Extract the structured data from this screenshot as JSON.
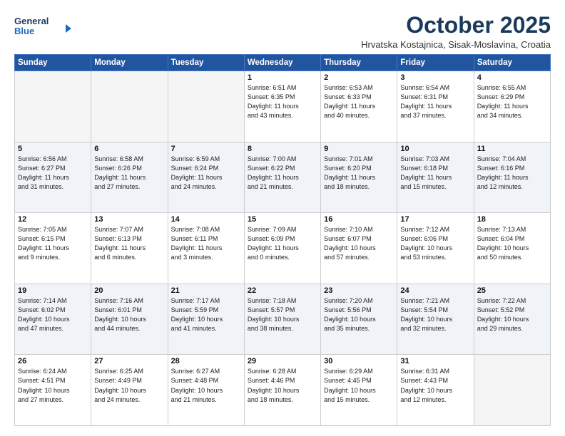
{
  "header": {
    "logo_line1": "General",
    "logo_line2": "Blue",
    "month": "October 2025",
    "location": "Hrvatska Kostajnica, Sisak-Moslavina, Croatia"
  },
  "days_of_week": [
    "Sunday",
    "Monday",
    "Tuesday",
    "Wednesday",
    "Thursday",
    "Friday",
    "Saturday"
  ],
  "weeks": [
    [
      {
        "day": "",
        "info": ""
      },
      {
        "day": "",
        "info": ""
      },
      {
        "day": "",
        "info": ""
      },
      {
        "day": "1",
        "info": "Sunrise: 6:51 AM\nSunset: 6:35 PM\nDaylight: 11 hours\nand 43 minutes."
      },
      {
        "day": "2",
        "info": "Sunrise: 6:53 AM\nSunset: 6:33 PM\nDaylight: 11 hours\nand 40 minutes."
      },
      {
        "day": "3",
        "info": "Sunrise: 6:54 AM\nSunset: 6:31 PM\nDaylight: 11 hours\nand 37 minutes."
      },
      {
        "day": "4",
        "info": "Sunrise: 6:55 AM\nSunset: 6:29 PM\nDaylight: 11 hours\nand 34 minutes."
      }
    ],
    [
      {
        "day": "5",
        "info": "Sunrise: 6:56 AM\nSunset: 6:27 PM\nDaylight: 11 hours\nand 31 minutes."
      },
      {
        "day": "6",
        "info": "Sunrise: 6:58 AM\nSunset: 6:26 PM\nDaylight: 11 hours\nand 27 minutes."
      },
      {
        "day": "7",
        "info": "Sunrise: 6:59 AM\nSunset: 6:24 PM\nDaylight: 11 hours\nand 24 minutes."
      },
      {
        "day": "8",
        "info": "Sunrise: 7:00 AM\nSunset: 6:22 PM\nDaylight: 11 hours\nand 21 minutes."
      },
      {
        "day": "9",
        "info": "Sunrise: 7:01 AM\nSunset: 6:20 PM\nDaylight: 11 hours\nand 18 minutes."
      },
      {
        "day": "10",
        "info": "Sunrise: 7:03 AM\nSunset: 6:18 PM\nDaylight: 11 hours\nand 15 minutes."
      },
      {
        "day": "11",
        "info": "Sunrise: 7:04 AM\nSunset: 6:16 PM\nDaylight: 11 hours\nand 12 minutes."
      }
    ],
    [
      {
        "day": "12",
        "info": "Sunrise: 7:05 AM\nSunset: 6:15 PM\nDaylight: 11 hours\nand 9 minutes."
      },
      {
        "day": "13",
        "info": "Sunrise: 7:07 AM\nSunset: 6:13 PM\nDaylight: 11 hours\nand 6 minutes."
      },
      {
        "day": "14",
        "info": "Sunrise: 7:08 AM\nSunset: 6:11 PM\nDaylight: 11 hours\nand 3 minutes."
      },
      {
        "day": "15",
        "info": "Sunrise: 7:09 AM\nSunset: 6:09 PM\nDaylight: 11 hours\nand 0 minutes."
      },
      {
        "day": "16",
        "info": "Sunrise: 7:10 AM\nSunset: 6:07 PM\nDaylight: 10 hours\nand 57 minutes."
      },
      {
        "day": "17",
        "info": "Sunrise: 7:12 AM\nSunset: 6:06 PM\nDaylight: 10 hours\nand 53 minutes."
      },
      {
        "day": "18",
        "info": "Sunrise: 7:13 AM\nSunset: 6:04 PM\nDaylight: 10 hours\nand 50 minutes."
      }
    ],
    [
      {
        "day": "19",
        "info": "Sunrise: 7:14 AM\nSunset: 6:02 PM\nDaylight: 10 hours\nand 47 minutes."
      },
      {
        "day": "20",
        "info": "Sunrise: 7:16 AM\nSunset: 6:01 PM\nDaylight: 10 hours\nand 44 minutes."
      },
      {
        "day": "21",
        "info": "Sunrise: 7:17 AM\nSunset: 5:59 PM\nDaylight: 10 hours\nand 41 minutes."
      },
      {
        "day": "22",
        "info": "Sunrise: 7:18 AM\nSunset: 5:57 PM\nDaylight: 10 hours\nand 38 minutes."
      },
      {
        "day": "23",
        "info": "Sunrise: 7:20 AM\nSunset: 5:56 PM\nDaylight: 10 hours\nand 35 minutes."
      },
      {
        "day": "24",
        "info": "Sunrise: 7:21 AM\nSunset: 5:54 PM\nDaylight: 10 hours\nand 32 minutes."
      },
      {
        "day": "25",
        "info": "Sunrise: 7:22 AM\nSunset: 5:52 PM\nDaylight: 10 hours\nand 29 minutes."
      }
    ],
    [
      {
        "day": "26",
        "info": "Sunrise: 6:24 AM\nSunset: 4:51 PM\nDaylight: 10 hours\nand 27 minutes."
      },
      {
        "day": "27",
        "info": "Sunrise: 6:25 AM\nSunset: 4:49 PM\nDaylight: 10 hours\nand 24 minutes."
      },
      {
        "day": "28",
        "info": "Sunrise: 6:27 AM\nSunset: 4:48 PM\nDaylight: 10 hours\nand 21 minutes."
      },
      {
        "day": "29",
        "info": "Sunrise: 6:28 AM\nSunset: 4:46 PM\nDaylight: 10 hours\nand 18 minutes."
      },
      {
        "day": "30",
        "info": "Sunrise: 6:29 AM\nSunset: 4:45 PM\nDaylight: 10 hours\nand 15 minutes."
      },
      {
        "day": "31",
        "info": "Sunrise: 6:31 AM\nSunset: 4:43 PM\nDaylight: 10 hours\nand 12 minutes."
      },
      {
        "day": "",
        "info": ""
      }
    ]
  ]
}
